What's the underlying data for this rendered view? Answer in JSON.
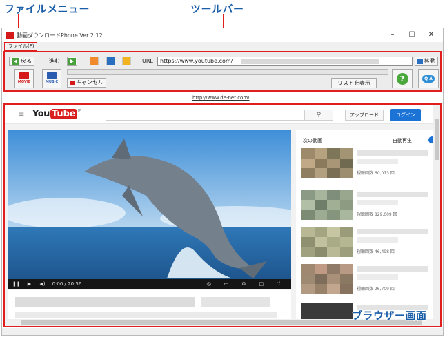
{
  "callouts": {
    "file_menu": "ファイルメニュー",
    "toolbar": "ツールバー",
    "browser": "ブラウザー画面"
  },
  "window": {
    "title": "動画ダウンロードPhone Ver 2.12",
    "min": "–",
    "max": "☐",
    "close": "✕"
  },
  "menu": {
    "file": "ファイル(F)"
  },
  "toolbar": {
    "back": "戻る",
    "forward": "進む",
    "url_label": "URL",
    "url_value": "https://www.youtube.com/",
    "go": "移動",
    "movie": "MOVIE",
    "music": "MUSIC",
    "cancel": "キャンセル",
    "list": "リストを表示",
    "help": "?",
    "qa": "Q A"
  },
  "site_link": "http://www.de-net.com/",
  "youtube": {
    "logo_you": "You",
    "logo_tube": "Tube",
    "logo_region": "JP",
    "upload": "アップロード",
    "login": "ログイン",
    "time": "0:00 / 20:56",
    "next_videos": "次の動画",
    "autoplay": "自動再生",
    "recommendations": [
      {
        "views": "視聴回数 60,073 回"
      },
      {
        "views": "視聴回数 829,009 回"
      },
      {
        "views": "視聴回数 46,498 回"
      },
      {
        "views": "視聴回数 26,709 回"
      }
    ]
  },
  "colors": {
    "accent_red": "#e01e1e",
    "callout_blue": "#1b5ea8",
    "youtube_red": "#d81e1e",
    "login_blue": "#1b73d5"
  }
}
